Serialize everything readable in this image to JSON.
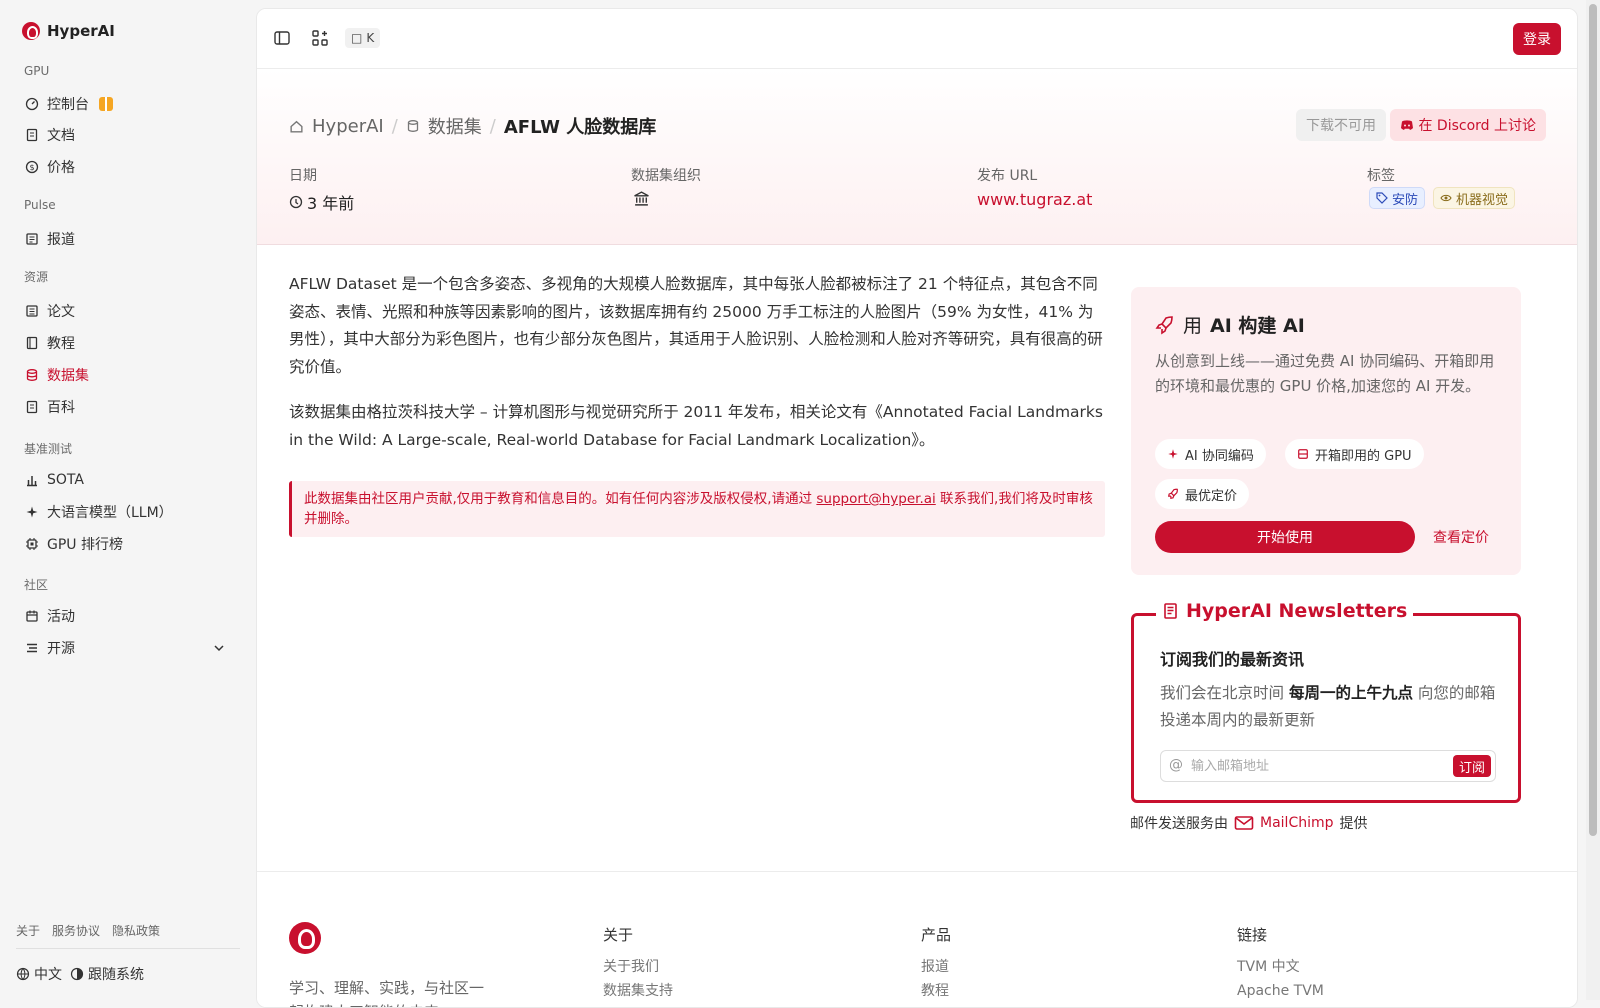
{
  "brand": "HyperAI",
  "sidebar": {
    "sections": [
      {
        "label": "GPU",
        "items": [
          {
            "label": "控制台",
            "icon": "dashboard-icon"
          },
          {
            "label": "文档",
            "icon": "document-icon"
          },
          {
            "label": "价格",
            "icon": "dollar-icon"
          }
        ]
      },
      {
        "label": "Pulse",
        "items": [
          {
            "label": "报道",
            "icon": "news-icon"
          }
        ]
      },
      {
        "label": "资源",
        "items": [
          {
            "label": "论文",
            "icon": "paper-icon"
          },
          {
            "label": "教程",
            "icon": "book-icon"
          },
          {
            "label": "数据集",
            "icon": "database-icon",
            "active": true
          },
          {
            "label": "百科",
            "icon": "wiki-icon"
          }
        ]
      },
      {
        "label": "基准测试",
        "items": [
          {
            "label": "SOTA",
            "icon": "bar-chart-icon"
          },
          {
            "label": "大语言模型（LLM）",
            "icon": "sparkle-icon"
          },
          {
            "label": "GPU 排行榜",
            "icon": "chip-icon"
          }
        ]
      },
      {
        "label": "社区",
        "items": [
          {
            "label": "活动",
            "icon": "calendar-icon"
          },
          {
            "label": "开源",
            "icon": "list-icon"
          }
        ]
      }
    ],
    "footer_links": [
      "关于",
      "服务协议",
      "隐私政策"
    ],
    "language": "中文",
    "theme": "跟随系统"
  },
  "topbar": {
    "kbd": "K",
    "login": "登录"
  },
  "breadcrumb": {
    "home": "HyperAI",
    "section": "数据集",
    "current": "AFLW 人脸数据库"
  },
  "actions": {
    "download": "下载不可用",
    "discord": "在 Discord 上讨论"
  },
  "meta": {
    "date_label": "日期",
    "date_value": "3 年前",
    "org_label": "数据集组织",
    "url_label": "发布 URL",
    "url_value": "www.tugraz.at",
    "tags_label": "标签",
    "tags": [
      "安防",
      "机器视觉"
    ]
  },
  "description": {
    "p1": "AFLW Dataset 是一个包含多姿态、多视角的大规模人脸数据库，其中每张人脸都被标注了 21 个特征点，其包含不同姿态、表情、光照和种族等因素影响的图片，该数据库拥有约 25000 万手工标注的人脸图片（59% 为女性，41% 为男性），其中大部分为彩色图片，也有少部分灰色图片，其适用于人脸识别、人脸检测和人脸对齐等研究，具有很高的研究价值。",
    "p2": "该数据集由格拉茨科技大学 – 计算机图形与视觉研究所于 2011 年发布，相关论文有《Annotated Facial Landmarks in the Wild: A Large-scale, Real-world Database for Facial Landmark Localization》。"
  },
  "notice": {
    "before": "此数据集由社区用户贡献,仅用于教育和信息目的。如有任何内容涉及版权侵权,请通过 ",
    "email": "support@hyper.ai",
    "after": " 联系我们,我们将及时审核并删除。"
  },
  "build": {
    "title_prefix": "用",
    "title_bold": "AI 构建 AI",
    "desc": "从创意到上线——通过免费 AI 协同编码、开箱即用的环境和最优惠的 GPU 价格,加速您的 AI 开发。",
    "chips": [
      "AI 协同编码",
      "开箱即用的 GPU",
      "最优定价"
    ],
    "start": "开始使用",
    "pricing": "查看定价"
  },
  "newsletter": {
    "title": "HyperAI Newsletters",
    "heading": "订阅我们的最新资讯",
    "desc_before": "我们会在北京时间 ",
    "desc_bold": "每周一的上午九点",
    "desc_after": " 向您的邮箱投递本周内的最新更新",
    "placeholder": "输入邮箱地址",
    "subscribe": "订阅"
  },
  "mailchimp": {
    "before": "邮件发送服务由",
    "brand": "MailChimp",
    "after": "提供"
  },
  "footer": {
    "tagline": "学习、理解、实践，与社区一起构建人工智能的未来",
    "cols": [
      {
        "title": "关于",
        "links": [
          "关于我们",
          "数据集支持"
        ]
      },
      {
        "title": "产品",
        "links": [
          "报道",
          "教程"
        ]
      },
      {
        "title": "链接",
        "links": [
          "TVM 中文",
          "Apache TVM"
        ]
      }
    ]
  }
}
